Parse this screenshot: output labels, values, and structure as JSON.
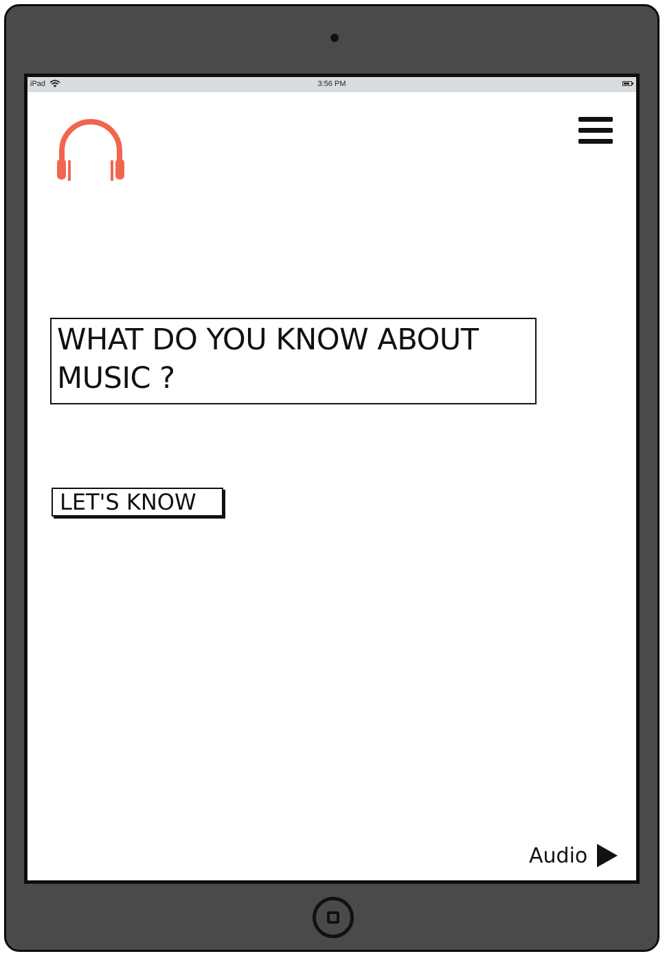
{
  "status_bar": {
    "device": "iPad",
    "time": "3:56 PM",
    "wifi_icon": "wifi-icon",
    "battery_icon": "battery-icon"
  },
  "logo": {
    "icon": "headphones-icon",
    "color": "#f0664f"
  },
  "menu": {
    "icon": "hamburger-menu-icon"
  },
  "main": {
    "headline": "WHAT DO YOU KNOW ABOUT MUSIC ?",
    "cta_label": "LET'S KNOW"
  },
  "audio": {
    "label": "Audio",
    "icon": "play-icon"
  },
  "device": {
    "frame_color": "#4a4a4a"
  }
}
